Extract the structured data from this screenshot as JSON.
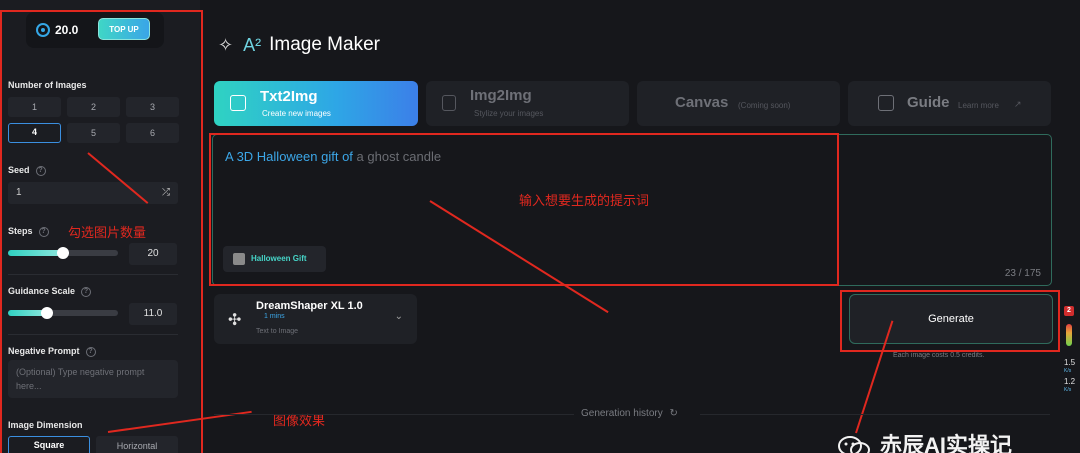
{
  "sidebar": {
    "credits": "20.0",
    "topup_label": "TOP UP",
    "num_images_label": "Number of Images",
    "num_options": [
      "1",
      "2",
      "3",
      "4",
      "5",
      "6"
    ],
    "num_selected": "4",
    "seed_label": "Seed",
    "seed_value": "1",
    "steps_label": "Steps",
    "steps_value": "20",
    "steps_fraction": 0.5,
    "guidance_label": "Guidance Scale",
    "guidance_value": "11.0",
    "guidance_fraction": 0.35,
    "negative_label": "Negative Prompt",
    "negative_placeholder": "(Optional) Type negative prompt here...",
    "dimension_label": "Image Dimension",
    "dimension_options": [
      "Square",
      "Horizontal"
    ],
    "dimension_selected": "Square"
  },
  "header": {
    "logo_text": "A²",
    "title": "Image Maker"
  },
  "tabs": [
    {
      "title": "Txt2Img",
      "sub": "Create new images",
      "active": true
    },
    {
      "title": "Img2Img",
      "sub": "Stylize your images",
      "active": false
    },
    {
      "title": "Canvas",
      "sub": "(Coming soon)",
      "active": false
    },
    {
      "title": "Guide",
      "sub": "Learn more",
      "active": false
    }
  ],
  "prompt": {
    "typed": "A 3D Halloween gift of",
    "suggestion": "a ghost candle",
    "tag": "Halloween Gift",
    "counter": "23 / 175"
  },
  "model": {
    "name": "DreamShaper XL 1.0",
    "time": "1 mins",
    "type": "Text to Image"
  },
  "generate": {
    "label": "Generate",
    "cost": "Each image costs 0.5 credits."
  },
  "history_label": "Generation history",
  "annotations": {
    "select_count": "勾选图片数量",
    "input_prompt": "输入想要生成的提示词",
    "image_effect": "图像效果"
  },
  "right_widget": {
    "badge": "2",
    "speed1": "1.5",
    "unit1": "K/s",
    "speed2": "1.2",
    "unit2": "K/s"
  },
  "watermark": "赤辰AI实操记",
  "colors": {
    "accent_teal": "#2fd3c2",
    "accent_blue": "#3ca7e8",
    "annotation_red": "#e0281f"
  }
}
